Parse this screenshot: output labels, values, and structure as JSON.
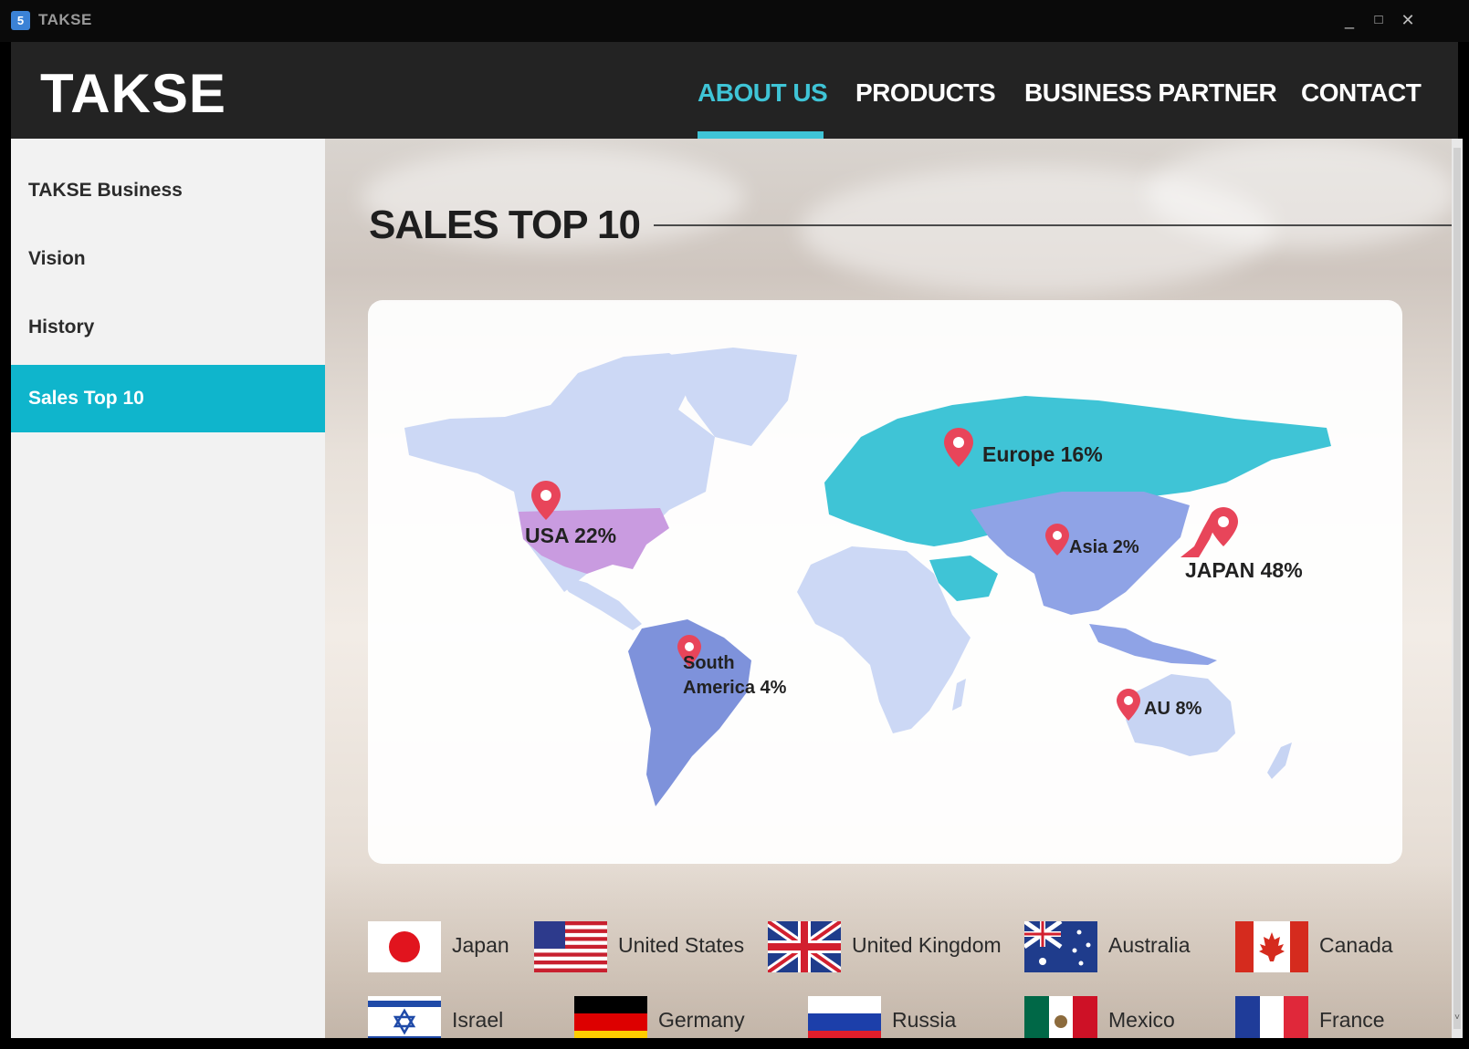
{
  "window": {
    "title": "TAKSE",
    "icon": "app-icon",
    "minimize": "_",
    "maximize": "□",
    "close": "✕"
  },
  "header": {
    "brand": "TAKSE",
    "nav": [
      {
        "label": "ABOUT US",
        "active": true
      },
      {
        "label": "PRODUCTS",
        "active": false
      },
      {
        "label": "BUSINESS PARTNER",
        "active": false
      },
      {
        "label": "CONTACT",
        "active": false
      }
    ]
  },
  "sidebar": {
    "items": [
      {
        "label": "TAKSE Business",
        "active": false
      },
      {
        "label": "Vision",
        "active": false
      },
      {
        "label": "History",
        "active": false
      },
      {
        "label": "Sales Top 10",
        "active": true
      }
    ]
  },
  "main": {
    "title": "SALES TOP 10",
    "map": {
      "regions": [
        {
          "name": "USA",
          "share": "22%",
          "label": "USA 22%",
          "color": "#c99be0"
        },
        {
          "name": "Europe",
          "share": "16%",
          "label": "Europe 16%",
          "color": "#3fc4d6"
        },
        {
          "name": "Asia",
          "share": "2%",
          "label": "Asia 2%",
          "color": "#8fa3e6"
        },
        {
          "name": "JAPAN",
          "share": "48%",
          "label": "JAPAN 48%",
          "color": "#e8455a"
        },
        {
          "name": "South America",
          "share": "4%",
          "label": "South America 4%",
          "color": "#7e92db"
        },
        {
          "name": "AU",
          "share": "8%",
          "label": "AU 8%",
          "color": "#c7d4f3"
        }
      ],
      "base_color": "#ccd8f5",
      "pin_color": "#e8455a"
    },
    "countries": [
      {
        "name": "Japan",
        "flag": "japan-flag-icon"
      },
      {
        "name": "United States",
        "flag": "usa-flag-icon"
      },
      {
        "name": "United Kingdom",
        "flag": "uk-flag-icon"
      },
      {
        "name": "Australia",
        "flag": "australia-flag-icon"
      },
      {
        "name": "Canada",
        "flag": "canada-flag-icon"
      },
      {
        "name": "Israel",
        "flag": "israel-flag-icon"
      },
      {
        "name": "Germany",
        "flag": "germany-flag-icon"
      },
      {
        "name": "Russia",
        "flag": "russia-flag-icon"
      },
      {
        "name": "Mexico",
        "flag": "mexico-flag-icon"
      },
      {
        "name": "France",
        "flag": "france-flag-icon"
      }
    ]
  }
}
